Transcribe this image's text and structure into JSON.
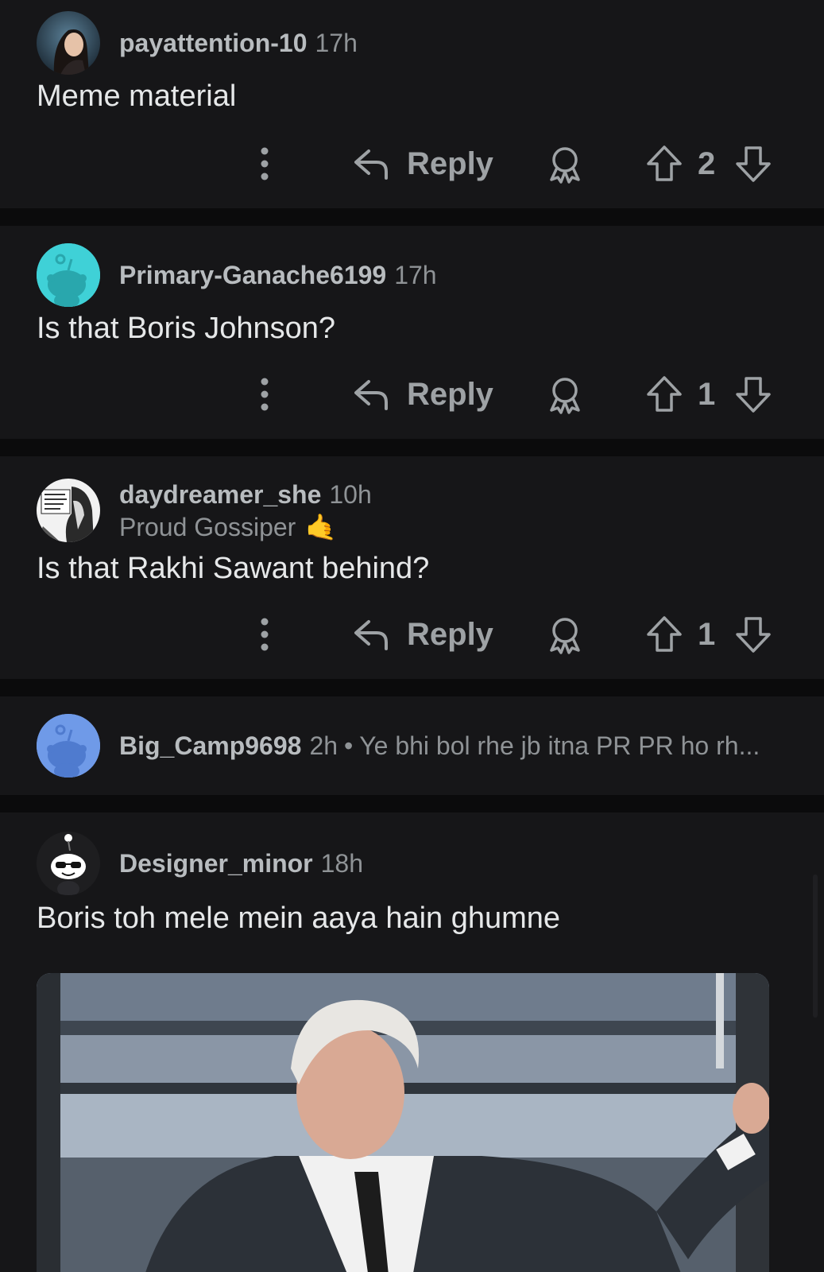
{
  "comments": [
    {
      "username": "payattention-10",
      "time": "17h",
      "body": "Meme material",
      "reply_label": "Reply",
      "score": "2"
    },
    {
      "username": "Primary-Ganache6199",
      "time": "17h",
      "body": "Is that Boris Johnson?",
      "reply_label": "Reply",
      "score": "1",
      "avatar_color": "#3fd1d7"
    },
    {
      "username": "daydreamer_she",
      "time": "10h",
      "flair": "Proud Gossiper",
      "flair_emoji": "🤙",
      "body": "Is that Rakhi Sawant behind?",
      "reply_label": "Reply",
      "score": "1"
    },
    {
      "username": "Big_Camp9698",
      "time": "2h",
      "separator": "•",
      "preview": "Ye bhi bol rhe jb itna PR PR ho rh...",
      "avatar_color": "#6f9ae8"
    },
    {
      "username": "Designer_minor",
      "time": "18h",
      "body": "Boris toh mele mein aaya hain ghumne"
    }
  ],
  "colors": {
    "background": "#0b0b0c",
    "card": "#161618",
    "text": "#e6e8e9",
    "muted": "#8f9396",
    "action": "#9ea2a5"
  },
  "icons": [
    "more-vertical-icon",
    "reply-arrow-icon",
    "award-icon",
    "upvote-arrow-icon",
    "downvote-arrow-icon",
    "snoo-avatar-icon"
  ]
}
